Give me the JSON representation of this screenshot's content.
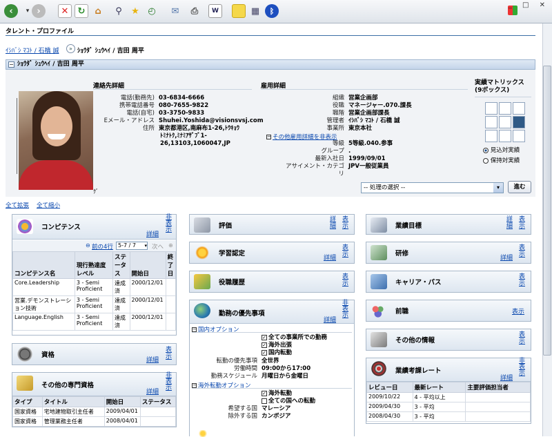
{
  "window": {
    "controls": "_ □ ✕"
  },
  "page": {
    "title": "タレント・プロファイル"
  },
  "breadcrumb": {
    "parent": "ｲｼﾊﾞｼ ﾏｺﾄ / 石橋 誠",
    "separator": "»",
    "current": "ｼｮｳﾀﾞ ｼｭｳﾍｲ / 吉田 周平"
  },
  "header": {
    "name": "ｼｮｳﾀﾞ ｼｭｳﾍｲ / 吉田 周平",
    "toggle": "−"
  },
  "contact": {
    "title": "連絡先詳細",
    "fields": [
      {
        "label": "電話(勤務先)",
        "value": "03-6834-6666"
      },
      {
        "label": "携帯電話番号",
        "value": "080-7655-9822"
      },
      {
        "label": "電話(自宅)",
        "value": "03-3750-9833"
      },
      {
        "label": "Eメール・アドレス",
        "value": "Shuhei.Yoshida@visionsvsj.com"
      },
      {
        "label": "住所",
        "value": "東京都港区,南麻布1-26,ﾄｳｷｮｳ"
      }
    ],
    "address_line2": "ﾄﾐﾅﾄｸ,ﾐﾅﾐｱｻﾞﾌﾞ1-",
    "address_line3": "26,13103,1060047,JP"
  },
  "employment": {
    "title": "雇用詳細",
    "fields_top": [
      {
        "label": "組織",
        "value": "営業企画部"
      },
      {
        "label": "役職",
        "value": "マネージャー.070.課長"
      },
      {
        "label": "職階",
        "value": "営業企画部課長"
      },
      {
        "label": "管理者",
        "value": "ｲｼﾊﾞｼ ﾏｺﾄ / 石橋 誠"
      },
      {
        "label": "事業所",
        "value": "東京本社"
      }
    ],
    "hide_link": "その他雇用詳細を非表示",
    "fields_bottom": [
      {
        "label": "等級",
        "value": "5等級.040.参事"
      },
      {
        "label": "グループ",
        "value": "."
      },
      {
        "label": "最新入社日",
        "value": "1999/09/01"
      },
      {
        "label": "アサイメント・カテゴリ",
        "value": "JPV一般従業員"
      }
    ]
  },
  "matrix": {
    "title": "実績マトリックス(9ボックス)",
    "radio1": "見込対実績",
    "radio2": "保持対実績",
    "highlight": "#2f5a86"
  },
  "action": {
    "select": "-- 処理の選択 --",
    "go": "進む"
  },
  "expand": {
    "all_expand": "全て拡張",
    "all_collapse": "全て縮小"
  },
  "left": {
    "competence": {
      "title": "コンピテンス",
      "detail": "詳細",
      "hide": "非表示",
      "prev": "前の4行",
      "range": "5-7 / 7",
      "next": "次へ",
      "columns": [
        "コンピテンス名",
        "現行熟達度レベル",
        "ステータス",
        "開始日",
        "終了日"
      ],
      "rows": [
        [
          "Core.Leadership",
          "3 - Semi Proficient",
          "達成済",
          "2000/12/01",
          ""
        ],
        [
          "営業.デモンストレーション技術",
          "3 - Semi Proficient",
          "達成済",
          "2000/12/01",
          ""
        ],
        [
          "Language.English",
          "3 - Semi Proficient",
          "達成済",
          "2000/12/01",
          ""
        ]
      ]
    },
    "qualification": {
      "title": "資格",
      "detail": "詳細",
      "show": "表示"
    },
    "other_special": {
      "title": "その他の専門資格",
      "detail": "詳細",
      "hide": "非表示",
      "columns": [
        "タイプ",
        "タイトル",
        "開始日",
        "ステータス"
      ],
      "rows": [
        [
          "国家資格",
          "宅地建物取引主任者",
          "2009/04/01",
          ""
        ],
        [
          "国家資格",
          "管理業務主任者",
          "2008/04/01",
          ""
        ]
      ]
    }
  },
  "middle": {
    "evaluation": {
      "title": "評価",
      "detail": "詳細",
      "show": "表示"
    },
    "learning": {
      "title": "学習認定",
      "detail": "詳細",
      "show": "表示"
    },
    "role_history": {
      "title": "役職履歴",
      "show": "表示"
    },
    "work_pref": {
      "title": "勤務の優先事項",
      "detail": "詳細",
      "hide": "非表示",
      "domestic_link": "国内オプション",
      "checks": [
        {
          "checked": "✓",
          "label": "全ての事業所での勤務"
        },
        {
          "checked": "✓",
          "label": "海外出張"
        },
        {
          "checked": "✓",
          "label": "国内転勤"
        }
      ],
      "fields": [
        {
          "label": "転勤の優先事項",
          "value": "全世界"
        },
        {
          "label": "労働時間",
          "value": "09:00から17:00"
        },
        {
          "label": "勤務スケジュール",
          "value": "月曜日から金曜日"
        }
      ],
      "overseas_link": "海外転勤オプション",
      "checks2": [
        {
          "checked": "✓",
          "label": "海外転勤"
        },
        {
          "checked": "",
          "label": "全ての国への転勤"
        }
      ],
      "fields2": [
        {
          "label": "希望する国",
          "value": "マレーシア"
        },
        {
          "label": "除外する国",
          "value": "カンボジア"
        }
      ]
    }
  },
  "right": {
    "goals": {
      "title": "業績目標",
      "detail": "詳細",
      "show": "表示"
    },
    "training": {
      "title": "研修",
      "detail": "詳細",
      "show": "表示"
    },
    "career": {
      "title": "キャリア・パス",
      "show": "表示"
    },
    "previous": {
      "title": "前職",
      "show": "表示"
    },
    "other_info": {
      "title": "その他の情報",
      "show": "表示"
    },
    "ratings": {
      "title": "業績考課レート",
      "detail": "詳細",
      "hide": "非表示",
      "columns": [
        "レビュー日",
        "最新レート",
        "主要評価担当者"
      ],
      "rows": [
        [
          "2009/10/22",
          "4 - 平均以上",
          ""
        ],
        [
          "2009/04/30",
          "3 - 平均",
          ""
        ],
        [
          "2008/04/30",
          "3 - 平均",
          ""
        ]
      ]
    }
  }
}
